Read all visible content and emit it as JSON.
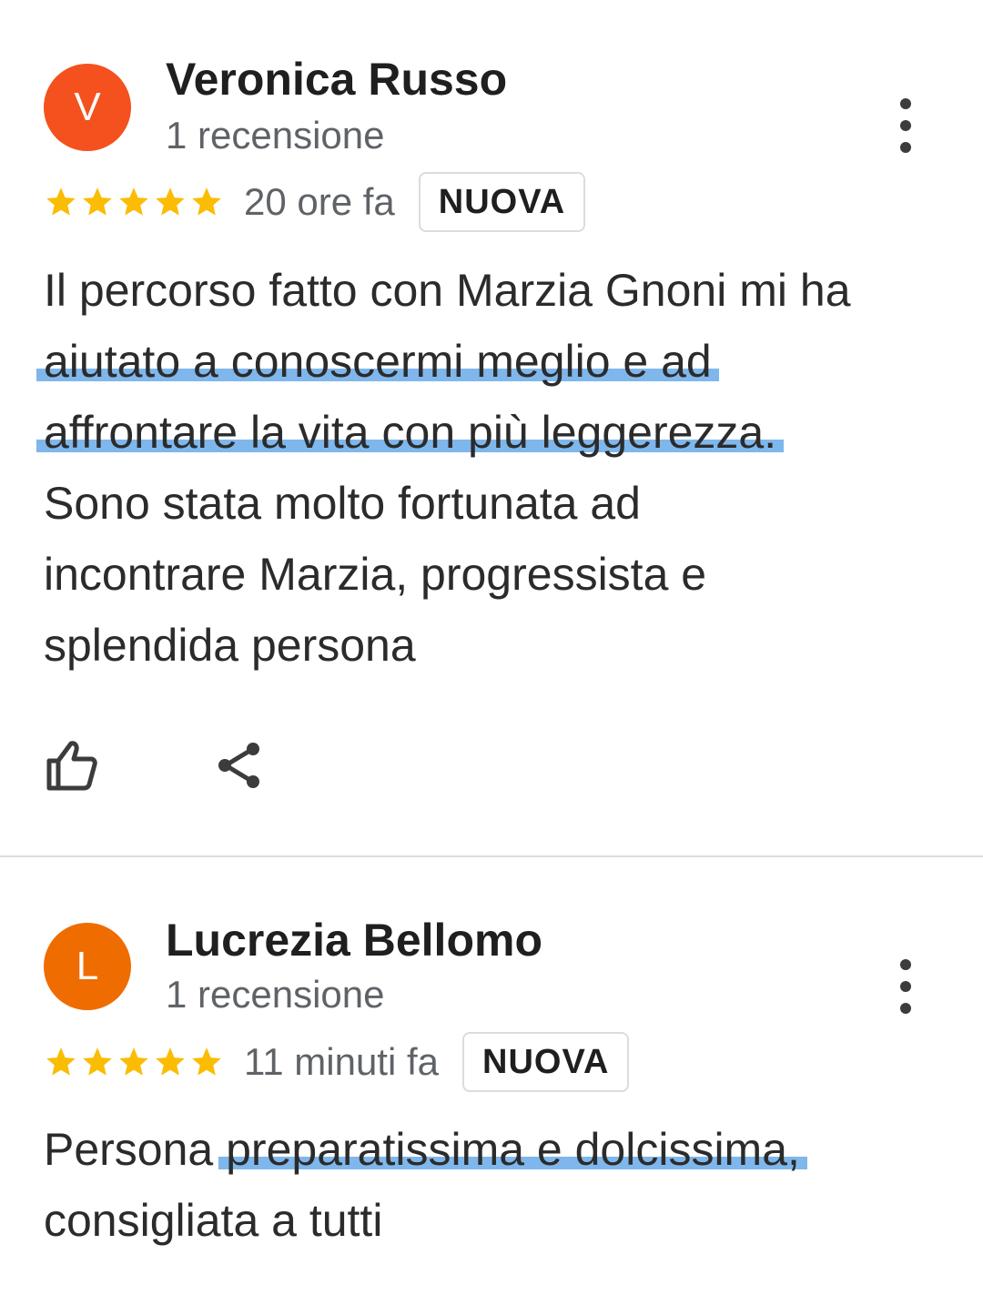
{
  "colors": {
    "avatar_v": "#f4511e",
    "avatar_l": "#ef6c00",
    "star": "#fbbc04",
    "highlight": "#7fb7ec"
  },
  "reviews": [
    {
      "avatar_letter": "V",
      "name": "Veronica Russo",
      "review_count": "1 recensione",
      "rating": 5,
      "time": "20 ore fa",
      "badge": "NUOVA",
      "lines": [
        "Il percorso fatto con Marzia Gnoni mi ha",
        "aiutato a conoscermi meglio e ad",
        "affrontare la vita con più leggerezza.",
        "Sono stata molto fortunata ad",
        "incontrare Marzia, progressista e",
        "splendida persona"
      ],
      "icons": [
        "thumb-up-icon",
        "share-icon",
        "more-vert-icon"
      ]
    },
    {
      "avatar_letter": "L",
      "name": "Lucrezia Bellomo",
      "review_count": "1 recensione",
      "rating": 5,
      "time": "11 minuti fa",
      "badge": "NUOVA",
      "line1_prefix": "Persona ",
      "line1_highlight": "preparatissima e dolcissima,",
      "line2": "consigliata a tutti",
      "icons": [
        "more-vert-icon"
      ]
    }
  ]
}
